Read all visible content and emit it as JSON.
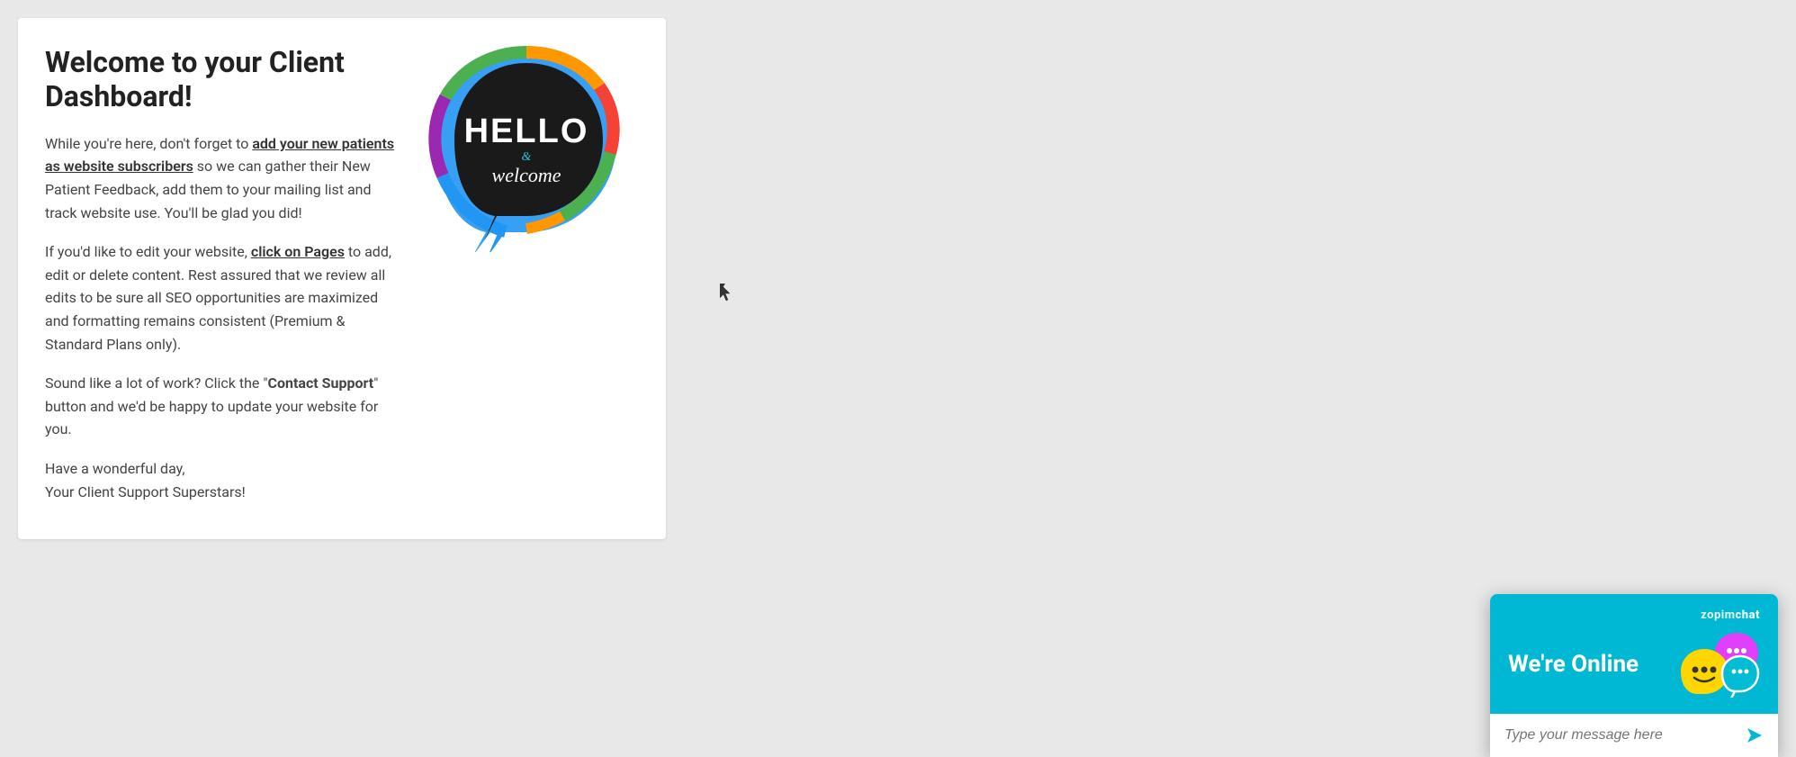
{
  "page": {
    "background": "#e8e8e8"
  },
  "dashboard": {
    "title": "Welcome to your Client Dashboard!",
    "paragraph1_pre": "While you're here, don't forget to ",
    "paragraph1_link": "add your new patients as website subscribers",
    "paragraph1_post": " so we can gather their New Patient Feedback, add them to your mailing list and track website use. You'll be glad you did!",
    "paragraph2_pre": "If you'd like to edit your website, ",
    "paragraph2_link": "click on Pages",
    "paragraph2_post": " to add, edit or delete content. Rest assured that we review all edits to be sure all SEO opportunities are maximized and formatting remains consistent (Premium & Standard Plans only).",
    "paragraph3_pre": "Sound like a lot of work? Click the \"",
    "paragraph3_bold": "Contact Support",
    "paragraph3_post": "\" button and we'd be happy to update your website for you.",
    "paragraph4_line1": "Have a wonderful day,",
    "paragraph4_line2": "Your Client Support Superstars!"
  },
  "hello_image": {
    "alt": "Hello and Welcome speech bubble"
  },
  "chat_widget": {
    "brand_pre": "zopim",
    "brand_bold": "chat",
    "status": "We're Online",
    "input_placeholder": "Type your message here",
    "colors": {
      "bg": "#00b8d4",
      "yellow": "#ffd600",
      "purple": "#e040fb",
      "cyan_border": "#00acc1"
    }
  }
}
